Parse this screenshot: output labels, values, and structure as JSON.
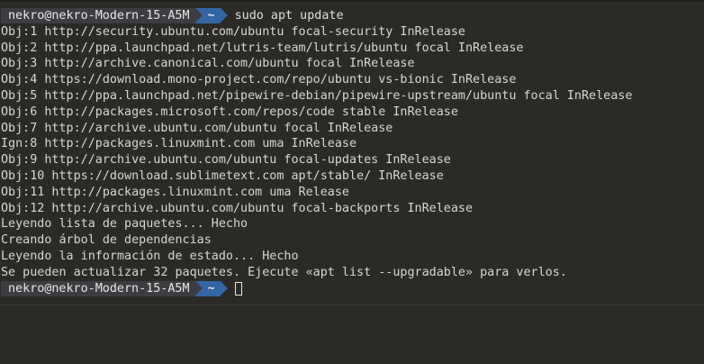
{
  "prompt": {
    "user_host": "nekro@nekro-Modern-15-A5M",
    "dir": "~"
  },
  "command": "sudo apt update",
  "output": [
    "Obj:1 http://security.ubuntu.com/ubuntu focal-security InRelease",
    "Obj:2 http://ppa.launchpad.net/lutris-team/lutris/ubuntu focal InRelease",
    "Obj:3 http://archive.canonical.com/ubuntu focal InRelease",
    "Obj:4 https://download.mono-project.com/repo/ubuntu vs-bionic InRelease",
    "Obj:5 http://ppa.launchpad.net/pipewire-debian/pipewire-upstream/ubuntu focal InRelease",
    "Obj:6 http://packages.microsoft.com/repos/code stable InRelease",
    "Obj:7 http://archive.ubuntu.com/ubuntu focal InRelease",
    "Ign:8 http://packages.linuxmint.com uma InRelease",
    "Obj:9 http://archive.ubuntu.com/ubuntu focal-updates InRelease",
    "Obj:10 https://download.sublimetext.com apt/stable/ InRelease",
    "Obj:11 http://packages.linuxmint.com uma Release",
    "Obj:12 http://archive.ubuntu.com/ubuntu focal-backports InRelease",
    "Leyendo lista de paquetes... Hecho",
    "Creando árbol de dependencias",
    "Leyendo la información de estado... Hecho",
    "Se pueden actualizar 32 paquetes. Ejecute «apt list --upgradable» para verlos."
  ],
  "colors": {
    "background": "#2b2a26",
    "text": "#d8d8d2",
    "prompt_user_bg": "#3b3d41",
    "prompt_dir_bg": "#3465a4"
  }
}
